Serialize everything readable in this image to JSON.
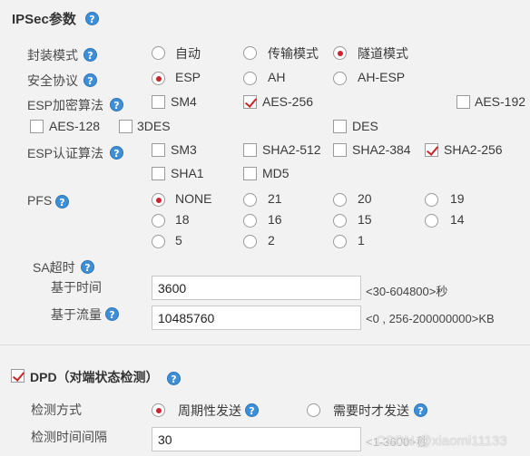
{
  "ipsec": {
    "title": "IPSec参数",
    "encap": {
      "label": "封装模式",
      "options": [
        "自动",
        "传输模式",
        "隧道模式"
      ],
      "selected": "隧道模式"
    },
    "protocol": {
      "label": "安全协议",
      "options": [
        "ESP",
        "AH",
        "AH-ESP"
      ],
      "selected": "ESP"
    },
    "enc": {
      "label": "ESP加密算法",
      "options": [
        "SM4",
        "AES-256",
        "AES-192",
        "AES-128",
        "3DES",
        "DES"
      ],
      "checked": [
        "AES-256"
      ]
    },
    "auth": {
      "label": "ESP认证算法",
      "options": [
        "SM3",
        "SHA2-512",
        "SHA2-384",
        "SHA2-256",
        "SHA1",
        "MD5"
      ],
      "checked": [
        "SHA2-256"
      ]
    },
    "pfs": {
      "label": "PFS",
      "options": [
        "NONE",
        "21",
        "20",
        "19",
        "18",
        "16",
        "15",
        "14",
        "5",
        "2",
        "1"
      ],
      "selected": "NONE"
    },
    "sa": {
      "label": "SA超时",
      "time_label": "基于时间",
      "time_value": "3600",
      "time_hint": "<30-604800>秒",
      "traffic_label": "基于流量",
      "traffic_value": "10485760",
      "traffic_hint": "<0 , 256-200000000>KB"
    }
  },
  "dpd": {
    "title": "DPD（对端状态检测）",
    "enabled": true,
    "mode": {
      "label": "检测方式",
      "options": [
        "周期性发送",
        "需要时才发送"
      ],
      "selected": "周期性发送"
    },
    "interval": {
      "label": "检测时间间隔",
      "value": "30",
      "hint": "<1-3600>秒"
    }
  },
  "watermark": "CSDN @xiaomi11133",
  "colors": {
    "accent": "#c9252c",
    "help": "#3f8fd6",
    "background": "#f2f2f2"
  }
}
